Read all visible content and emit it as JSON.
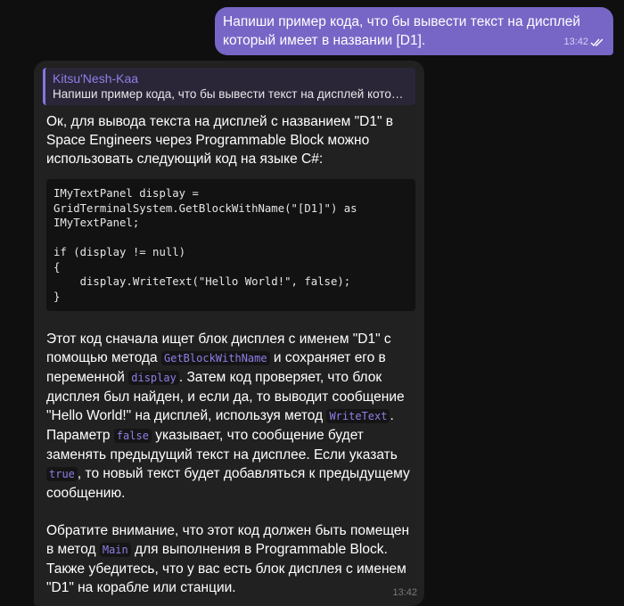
{
  "outgoing": {
    "text": "Напиши пример кода, что бы вывести текст на дисплей который имеет в названии [D1].",
    "time": "13:42",
    "status_icon": "double-check-icon"
  },
  "incoming": {
    "reply": {
      "name": "Kitsu'Nesh-Kaa",
      "text": "Напиши пример кода, что бы вывести текст на дисплей который имеет в названии [D1]."
    },
    "intro": "Ок, для вывода текста на дисплей с названием \"D1\" в Space Engineers через Programmable Block можно использовать следующий код на языке C#:",
    "code": "IMyTextPanel display =\nGridTerminalSystem.GetBlockWithName(\"[D1]\") as\nIMyTextPanel;\n\nif (display != null)\n{\n    display.WriteText(\"Hello World!\", false);\n}",
    "p2": [
      "Этот код сначала ищет блок дисплея с именем \"D1\" с помощью метода ",
      "GetBlockWithName",
      " и сохраняет его в переменной ",
      "display",
      ". Затем код проверяет, что блок дисплея был найден, и если да, то выводит сообщение \"Hello World!\" на дисплей, используя метод ",
      "WriteText",
      ". Параметр ",
      "false",
      " указывает, что сообщение будет заменять предыдущий текст на дисплее. Если указать ",
      "true",
      ", то новый текст будет добавляться к предыдущему сообщению."
    ],
    "p3": [
      "Обратите внимание, что этот код должен быть помещен в метод ",
      "Main",
      " для выполнения в Programmable Block. Также убедитесь, что у вас есть блок дисплея с именем \"D1\" на корабле или станции."
    ],
    "time": "13:42"
  },
  "colors": {
    "accent": "#7766c6",
    "bubble": "#212121",
    "background": "#0f0f0f"
  }
}
